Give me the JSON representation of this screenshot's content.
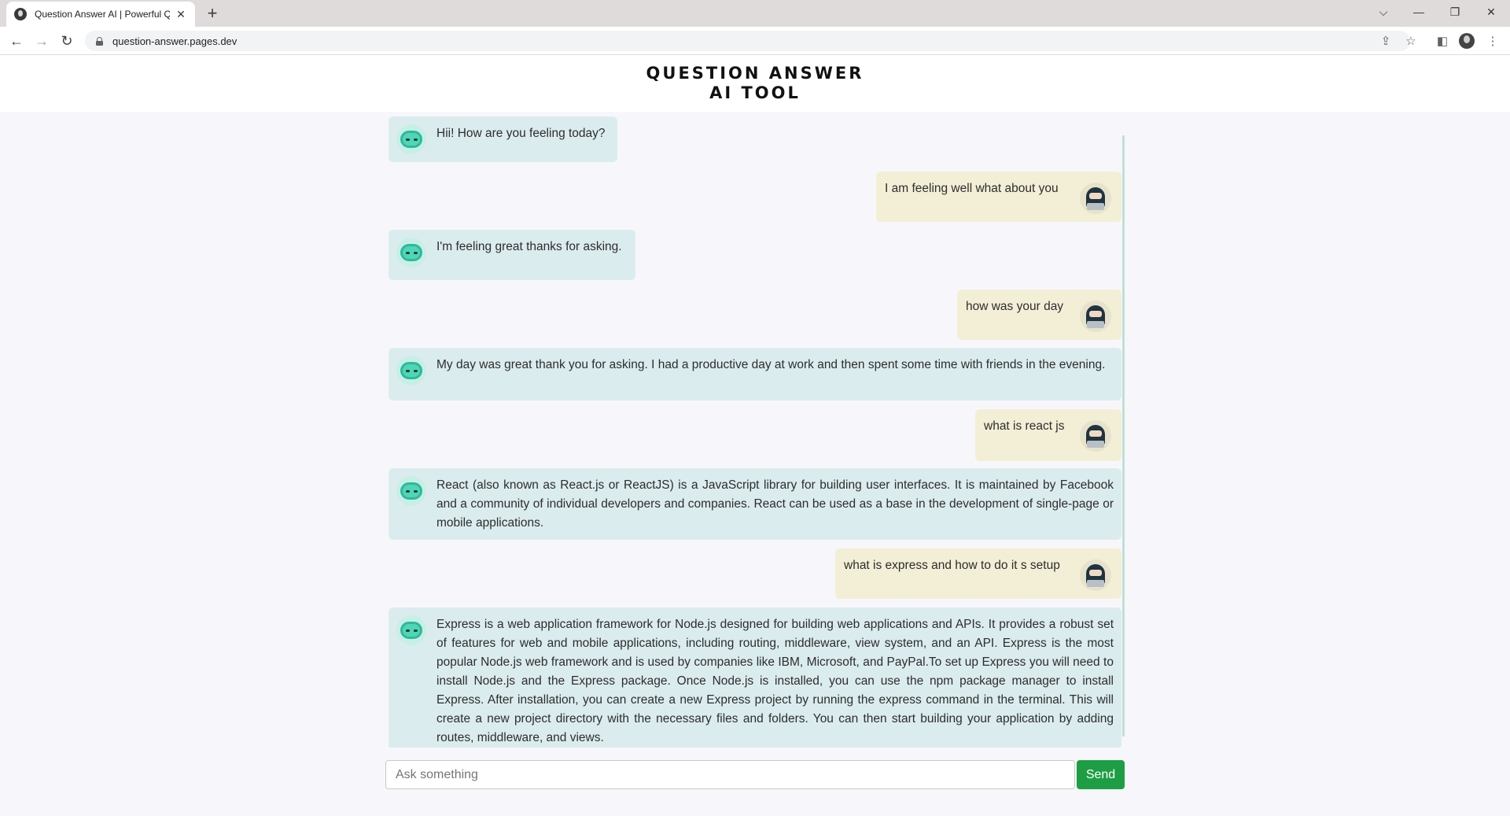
{
  "browser": {
    "tab_title": "Question Answer AI | Powerful Q",
    "url": "question-answer.pages.dev"
  },
  "header": {
    "title_line1": "QUESTION ANSWER",
    "title_line2": "AI TOOL"
  },
  "messages": [
    {
      "role": "bot",
      "text": "Hii! How are you feeling today?"
    },
    {
      "role": "user",
      "text": "I am feeling well what about you"
    },
    {
      "role": "bot",
      "text": "I'm feeling great thanks for asking."
    },
    {
      "role": "user",
      "text": "how was your day"
    },
    {
      "role": "bot",
      "text": "My day was great thank you for asking. I had a productive day at work and then spent some time with friends in the evening."
    },
    {
      "role": "user",
      "text": "what is react js"
    },
    {
      "role": "bot",
      "text": "React (also known as React.js or ReactJS) is a JavaScript library for building user interfaces. It is maintained by Facebook and a community of individual developers and companies. React can be used as a base in the development of single-page or mobile applications."
    },
    {
      "role": "user",
      "text": "what is express and how to do it s setup"
    },
    {
      "role": "bot",
      "text": "Express is a web application framework for Node.js designed for building web applications and APIs. It provides a robust set of features for web and mobile applications, including routing, middleware, view system, and an API. Express is the most popular Node.js web framework and is used by companies like IBM, Microsoft, and PayPal.To set up Express you will need to install Node.js and the Express package. Once Node.js is installed, you can use the npm package manager to install Express. After installation, you can create a new Express project by running the express command in the terminal. This will create a new project directory with the necessary files and folders. You can then start building your application by adding routes, middleware, and views."
    }
  ],
  "composer": {
    "placeholder": "Ask something",
    "send_label": "Send"
  },
  "colors": {
    "bot_bubble": "#dbecee",
    "user_bubble": "#f3efd6",
    "send_button": "#1e9e44"
  }
}
